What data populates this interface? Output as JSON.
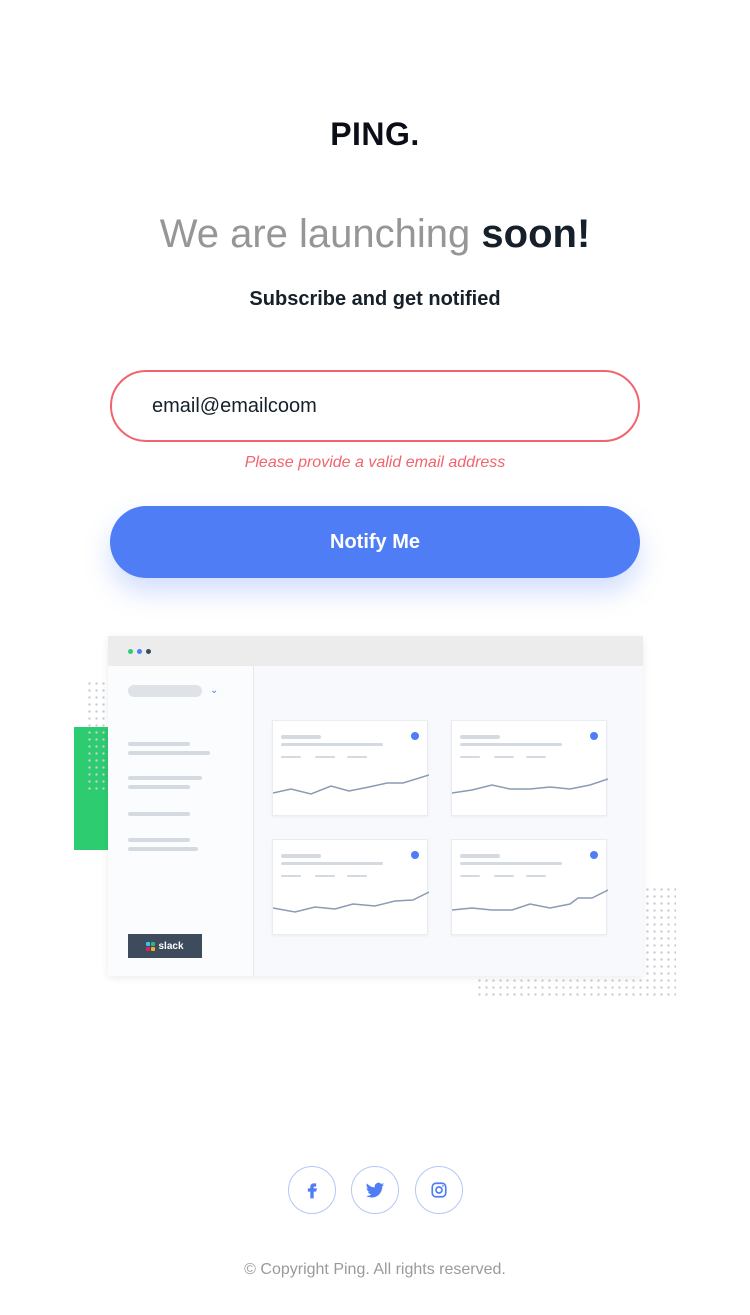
{
  "brand": {
    "logo": "PING."
  },
  "hero": {
    "headline_light": "We are launching ",
    "headline_bold": "soon!",
    "subline": "Subscribe and get notified"
  },
  "form": {
    "email_value": "email@emailcoom",
    "error": "Please provide a valid email address",
    "submit_label": "Notify Me"
  },
  "illustration": {
    "slack_label": "slack"
  },
  "social": [
    {
      "name": "facebook-icon"
    },
    {
      "name": "twitter-icon"
    },
    {
      "name": "instagram-icon"
    }
  ],
  "footer": {
    "copyright": "© Copyright Ping. All rights reserved."
  },
  "colors": {
    "accent": "#4e7df5",
    "error": "#f1646e",
    "dark": "#15202a",
    "muted": "#969696",
    "green": "#2ecc71"
  }
}
